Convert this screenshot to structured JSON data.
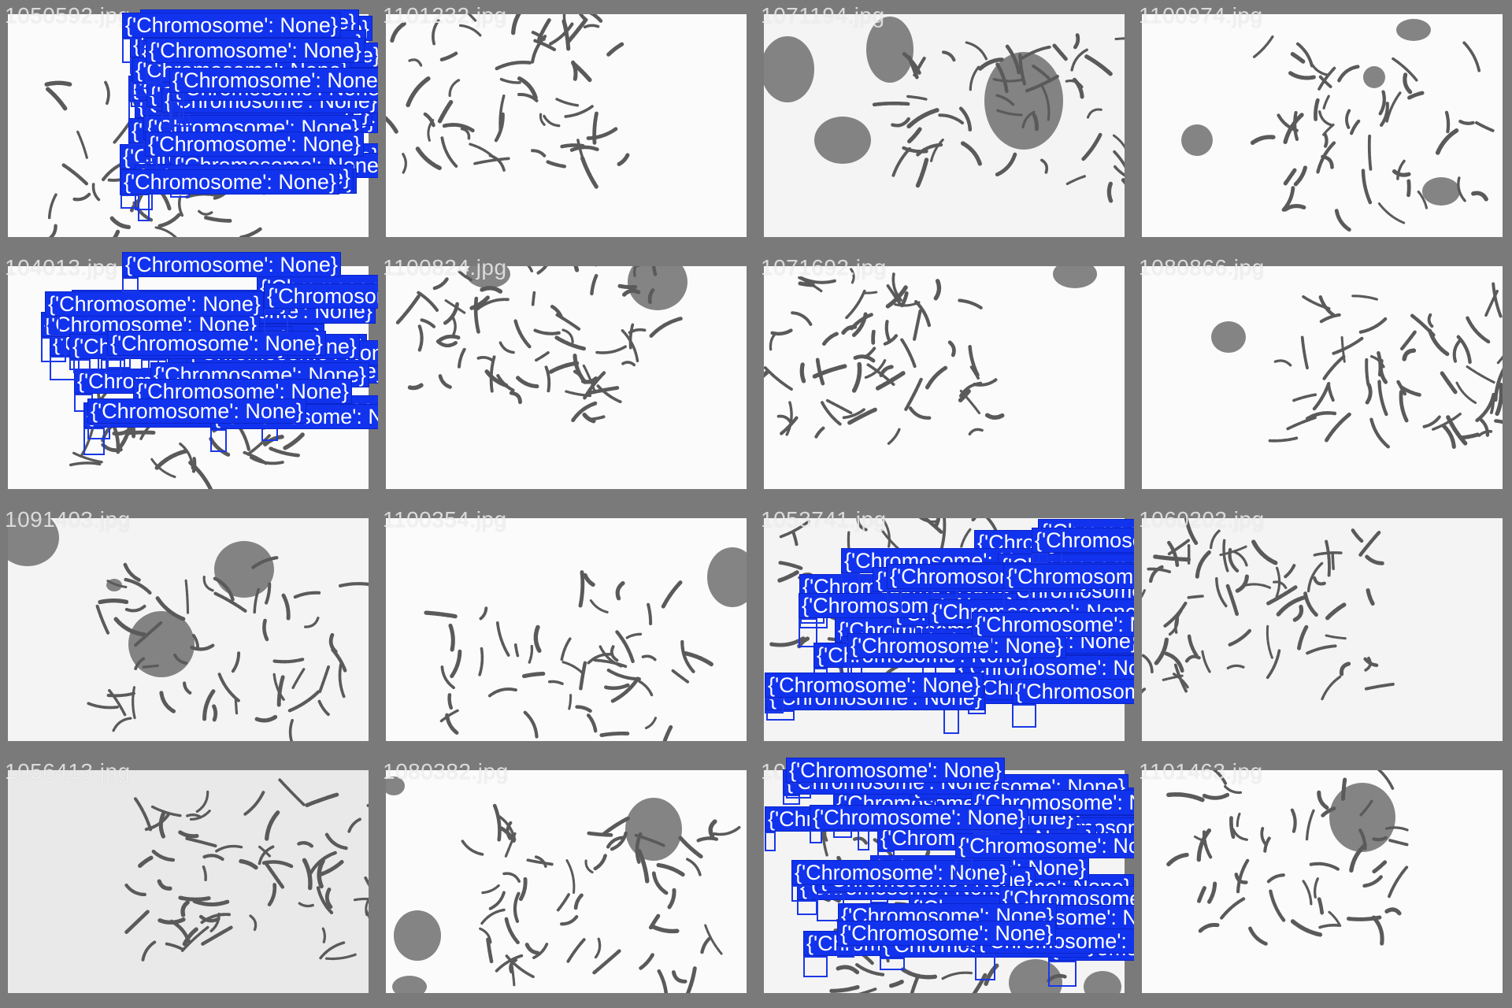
{
  "grid": {
    "cells": [
      {
        "file": "1050592.jpg",
        "detections": 34
      },
      {
        "file": "1101232.jpg",
        "detections": 0
      },
      {
        "file": "1071194.jpg",
        "detections": 0
      },
      {
        "file": "1100974.jpg",
        "detections": 0
      },
      {
        "file": "104013.jpg",
        "detections": 26
      },
      {
        "file": "1100824.jpg",
        "detections": 0
      },
      {
        "file": "1071692.jpg",
        "detections": 0
      },
      {
        "file": "1080866.jpg",
        "detections": 0
      },
      {
        "file": "1091403.jpg",
        "detections": 0
      },
      {
        "file": "1100354.jpg",
        "detections": 0
      },
      {
        "file": "1053741.jpg",
        "detections": 30
      },
      {
        "file": "1060202.jpg",
        "detections": 0
      },
      {
        "file": "1056413.jpg",
        "detections": 0
      },
      {
        "file": "1080382.jpg",
        "detections": 0
      },
      {
        "file": "1054673.jpg",
        "detections": 30
      },
      {
        "file": "1101463.jpg",
        "detections": 0
      }
    ]
  },
  "detection_label": "{'Chromosome': None}",
  "colors": {
    "background": "#7a7a7a",
    "label_fill": "#1133ee",
    "box_stroke": "#1a38e8",
    "chromosome": "#5a5a5a",
    "nucleus": "#6e6e6e"
  }
}
